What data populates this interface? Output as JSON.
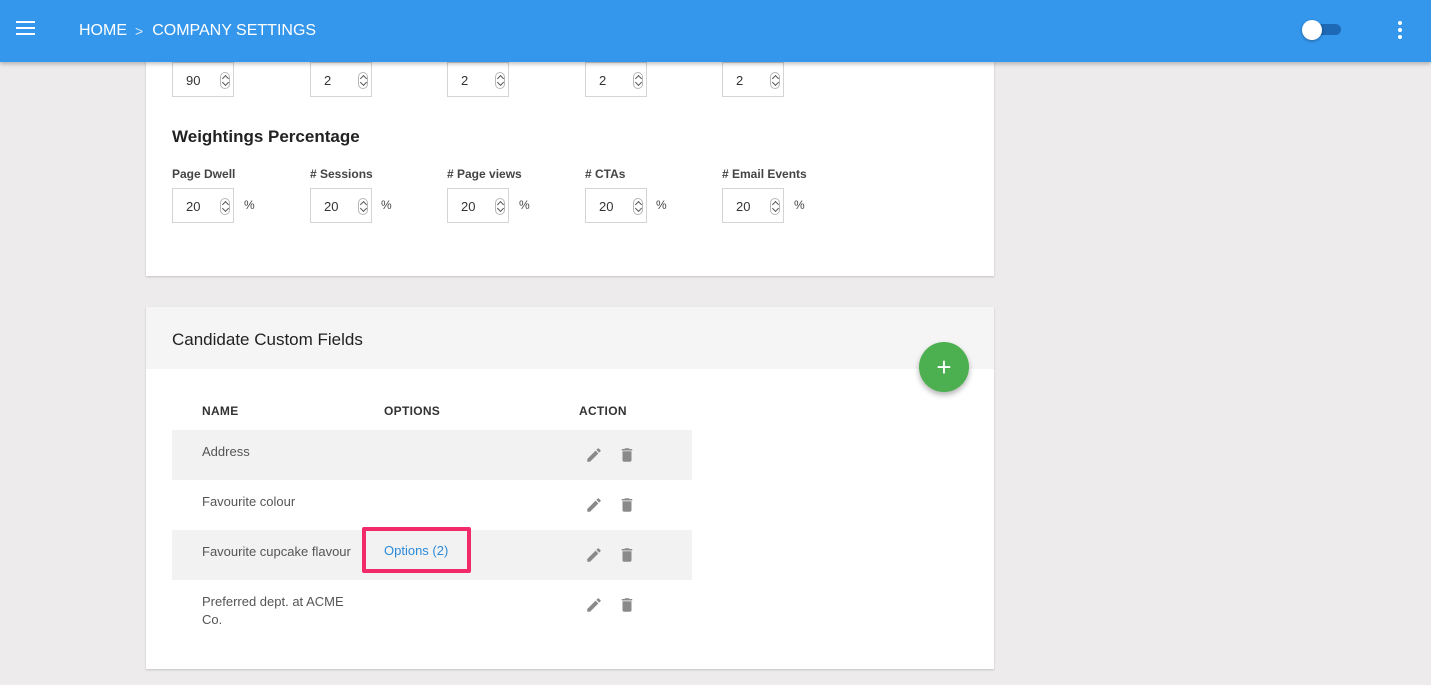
{
  "header": {
    "breadcrumb": {
      "home": "HOME",
      "separator": ">",
      "current": "COMPANY SETTINGS"
    },
    "toggle_state": "off"
  },
  "scoring": {
    "thresholds": [
      "90",
      "2",
      "2",
      "2",
      "2"
    ]
  },
  "weightings": {
    "title": "Weightings Percentage",
    "fields": [
      {
        "label": "Page Dwell",
        "value": "20",
        "unit": "%"
      },
      {
        "label": "# Sessions",
        "value": "20",
        "unit": "%"
      },
      {
        "label": "# Page views",
        "value": "20",
        "unit": "%"
      },
      {
        "label": "# CTAs",
        "value": "20",
        "unit": "%"
      },
      {
        "label": "# Email Events",
        "value": "20",
        "unit": "%"
      }
    ]
  },
  "custom_fields": {
    "title": "Candidate Custom Fields",
    "add_label": "+",
    "columns": [
      "NAME",
      "OPTIONS",
      "ACTION"
    ],
    "rows": [
      {
        "name": "Address",
        "options": ""
      },
      {
        "name": "Favourite colour",
        "options": ""
      },
      {
        "name": "Favourite cupcake flavour",
        "options": "Options (2)"
      },
      {
        "name": "Preferred dept. at ACME Co.",
        "options": ""
      }
    ]
  },
  "colors": {
    "topbar": "#3497ec",
    "fab": "#4caf50",
    "link": "#2b8ad8",
    "highlight": "#f32a69"
  },
  "icons": {
    "menu": "hamburger-menu-icon",
    "more": "more-vert-icon",
    "edit": "pencil-icon",
    "delete": "trash-icon",
    "add": "plus-icon"
  }
}
